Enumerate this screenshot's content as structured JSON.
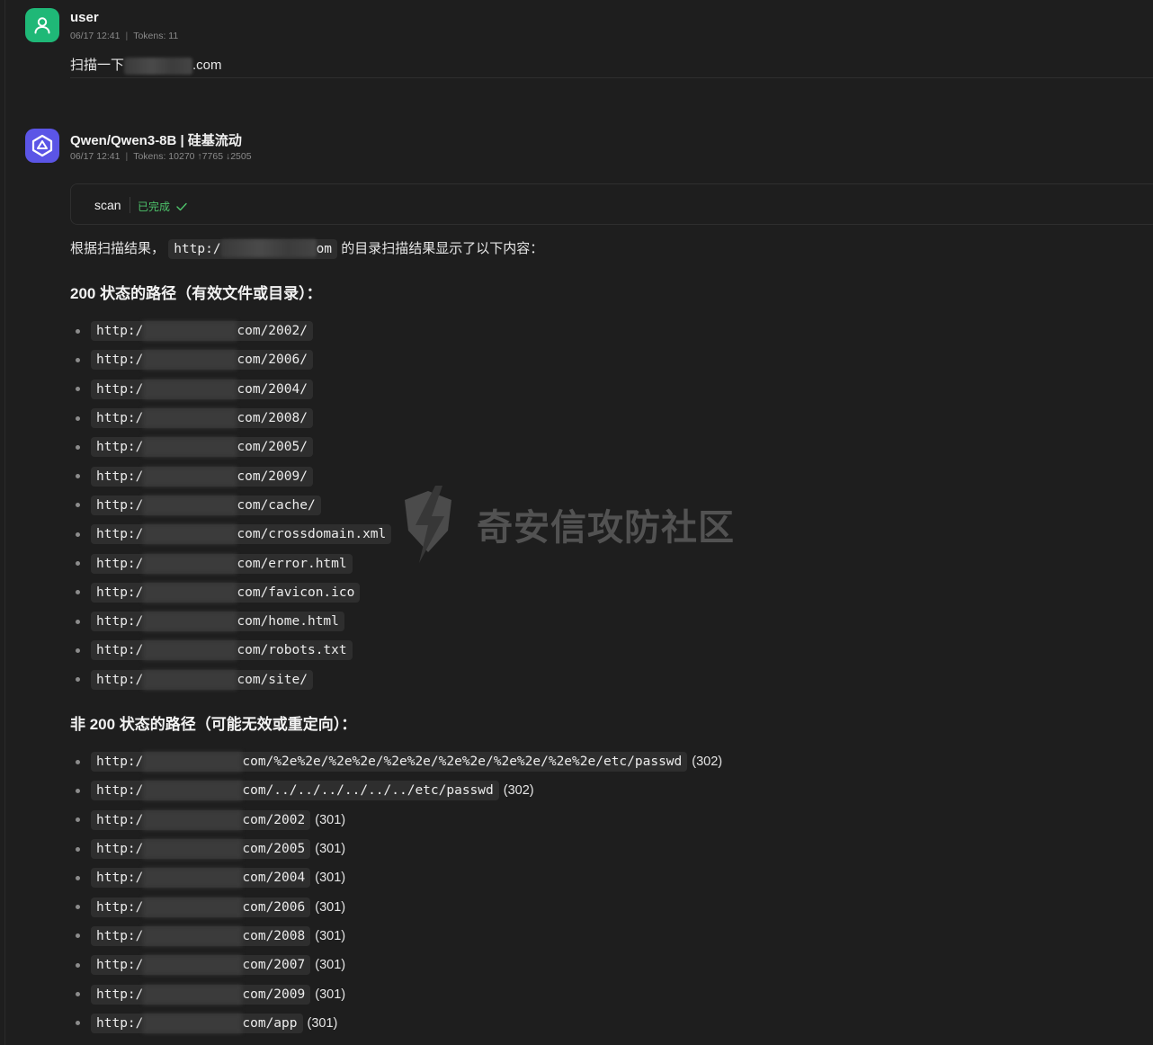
{
  "user": {
    "name": "user",
    "date": "06/17 12:41",
    "tokens": "Tokens: 11",
    "message_prefix": "扫描一下",
    "message_suffix": ".com"
  },
  "bot": {
    "name": "Qwen/Qwen3-8B | 硅基流动",
    "date": "06/17 12:41",
    "tokens": "Tokens: 10270 ↑7765 ↓2505"
  },
  "tool": {
    "name": "scan",
    "status": "已完成",
    "status_icon": "check-icon"
  },
  "intro": {
    "prefix": "根据扫描结果，",
    "code_start": "http:/",
    "code_end": "om",
    "suffix": " 的目录扫描结果显示了以下内容："
  },
  "section_200": {
    "title": "200 状态的路径（有效文件或目录）：",
    "items": [
      {
        "prefix": "http:/",
        "path": "com/2002/"
      },
      {
        "prefix": "http:/",
        "path": "com/2006/"
      },
      {
        "prefix": "http:/",
        "path": "com/2004/"
      },
      {
        "prefix": "http:/",
        "path": "com/2008/"
      },
      {
        "prefix": "http:/",
        "path": "com/2005/"
      },
      {
        "prefix": "http:/",
        "path": "com/2009/"
      },
      {
        "prefix": "http:/",
        "path": "com/cache/"
      },
      {
        "prefix": "http:/",
        "path": "com/crossdomain.xml"
      },
      {
        "prefix": "http:/",
        "path": "com/error.html"
      },
      {
        "prefix": "http:/",
        "path": "com/favicon.ico"
      },
      {
        "prefix": "http:/",
        "path": "com/home.html"
      },
      {
        "prefix": "http:/",
        "path": "com/robots.txt"
      },
      {
        "prefix": "http:/",
        "path": "com/site/"
      }
    ]
  },
  "section_non200": {
    "title": "非 200 状态的路径（可能无效或重定向）：",
    "items": [
      {
        "prefix": "http:/",
        "path": "com/%2e%2e/%2e%2e/%2e%2e/%2e%2e/%2e%2e/%2e%2e/etc/passwd",
        "status": "(302)"
      },
      {
        "prefix": "http:/",
        "path": "com/../../../../../../etc/passwd",
        "status": "(302)"
      },
      {
        "prefix": "http:/",
        "path": "com/2002",
        "status": "(301)"
      },
      {
        "prefix": "http:/",
        "path": "com/2005",
        "status": "(301)"
      },
      {
        "prefix": "http:/",
        "path": "com/2004",
        "status": "(301)"
      },
      {
        "prefix": "http:/",
        "path": "com/2006",
        "status": "(301)"
      },
      {
        "prefix": "http:/",
        "path": "com/2008",
        "status": "(301)"
      },
      {
        "prefix": "http:/",
        "path": "com/2007",
        "status": "(301)"
      },
      {
        "prefix": "http:/",
        "path": "com/2009",
        "status": "(301)"
      },
      {
        "prefix": "http:/",
        "path": "com/app",
        "status": "(301)"
      }
    ]
  },
  "watermark": {
    "text": "奇安信攻防社区"
  },
  "colors": {
    "background": "#1e1e1e",
    "user_avatar": "#1fb877",
    "bot_avatar": "#5b55e6",
    "success": "#4ec46b",
    "code_bg": "#2e2e2e"
  }
}
